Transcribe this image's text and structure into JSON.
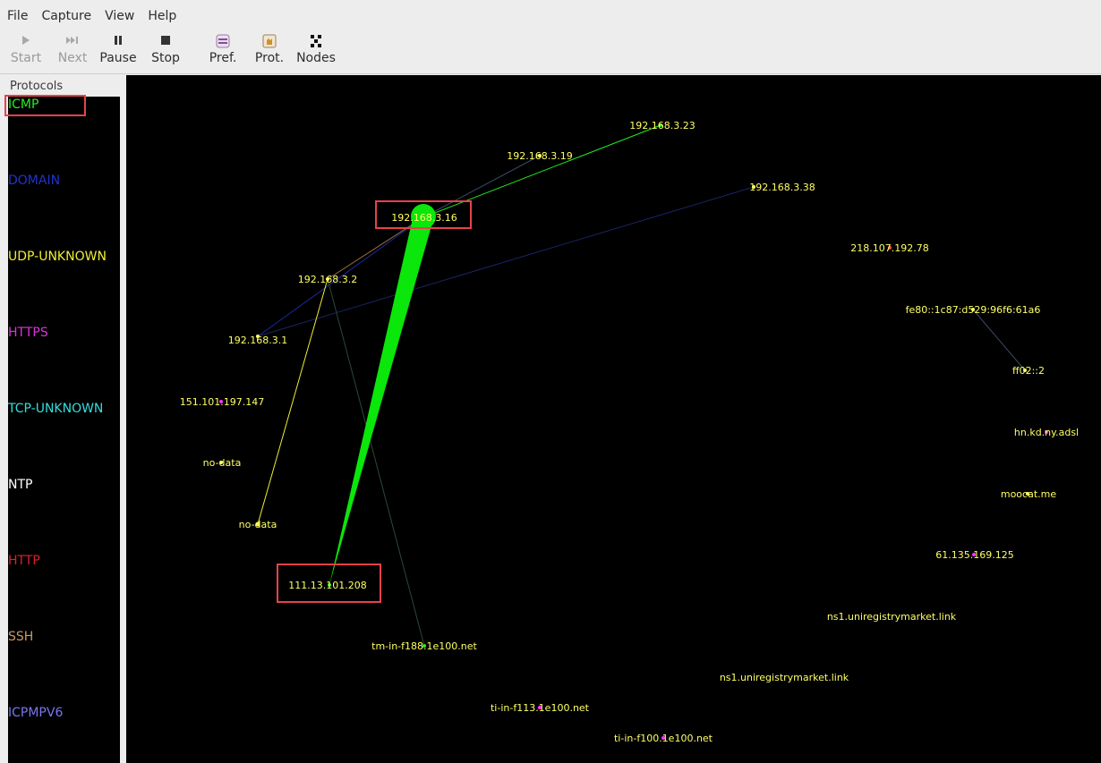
{
  "menu": [
    "File",
    "Capture",
    "View",
    "Help"
  ],
  "toolbar": {
    "start": "Start",
    "next": "Next",
    "pause": "Pause",
    "stop": "Stop",
    "pref": "Pref.",
    "prot": "Prot.",
    "nodes": "Nodes"
  },
  "protocols": {
    "title": "Protocols",
    "items": [
      {
        "name": "ICMP",
        "color": "#22ee22"
      },
      {
        "name": "DOMAIN",
        "color": "#2233cc"
      },
      {
        "name": "UDP-UNKNOWN",
        "color": "#eeee33"
      },
      {
        "name": "HTTPS",
        "color": "#dd33dd"
      },
      {
        "name": "TCP-UNKNOWN",
        "color": "#33dddd"
      },
      {
        "name": "NTP",
        "color": "#ffffff"
      },
      {
        "name": "HTTP",
        "color": "#dd2222"
      },
      {
        "name": "SSH",
        "color": "#cc9966"
      },
      {
        "name": "ICPMPV6",
        "color": "#7777ee"
      }
    ]
  },
  "nodes": [
    "192.168.3.23",
    "192.168.3.19",
    "192.168.3.38",
    "192.168.3.16",
    "218.107.192.78",
    "192.168.3.2",
    "fe80::1c87:d529:96f6:61a6",
    "192.168.3.1",
    "ff02::2",
    "151.101.197.147",
    "hn.kd.ny.adsl",
    "no-data",
    "moocat.me",
    "no-data",
    "61.135.169.125",
    "111.13.101.208",
    "ns1.uniregistrymarket.link",
    "tm-in-f188.1e100.net",
    "ns1.uniregistrymarket.link",
    "ti-in-f113.1e100.net",
    "ti-in-f100.1e100.net"
  ]
}
